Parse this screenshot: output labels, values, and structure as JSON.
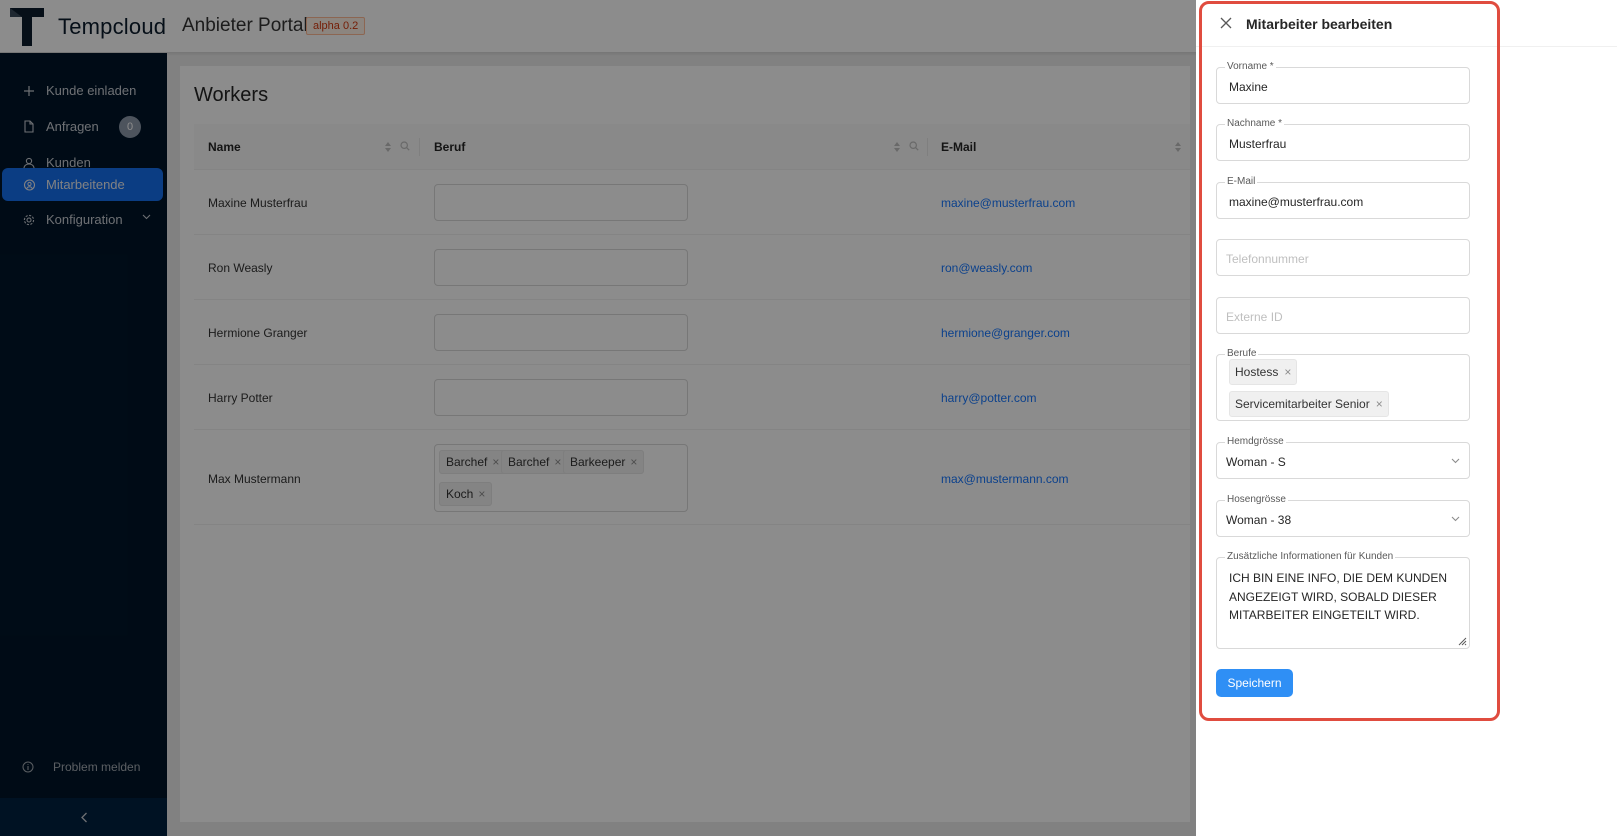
{
  "header": {
    "brand": "Tempcloud",
    "portal_title": "Anbieter Portal",
    "version_tag": "alpha 0.2"
  },
  "sidebar": {
    "items": [
      {
        "label": "Kunde einladen",
        "icon": "plus-icon"
      },
      {
        "label": "Anfragen",
        "icon": "file-icon",
        "badge": "0"
      },
      {
        "label": "Kunden",
        "icon": "user-icon"
      },
      {
        "label": "Mitarbeitende",
        "icon": "team-icon",
        "active": true
      },
      {
        "label": "Konfiguration",
        "icon": "gear-icon"
      }
    ],
    "footer": {
      "label": "Problem melden",
      "icon": "info-icon"
    },
    "collapse_icon": "chevron-left-icon"
  },
  "main": {
    "title": "Workers",
    "columns": [
      "Name",
      "Beruf",
      "E-Mail"
    ],
    "rows": [
      {
        "name": "Maxine Musterfrau",
        "email": "maxine@musterfrau.com",
        "tags": []
      },
      {
        "name": "Ron Weasly",
        "email": "ron@weasly.com",
        "tags": []
      },
      {
        "name": "Hermione Granger",
        "email": "hermione@granger.com",
        "tags": []
      },
      {
        "name": "Harry Potter",
        "email": "harry@potter.com",
        "tags": []
      },
      {
        "name": "Max Mustermann",
        "email": "max@mustermann.com",
        "tags": [
          "Barchef",
          "Barchef",
          "Barkeeper",
          "Koch"
        ]
      }
    ]
  },
  "drawer": {
    "title": "Mitarbeiter bearbeiten",
    "fields": {
      "vorname": {
        "label": "Vorname *",
        "value": "Maxine"
      },
      "nachname": {
        "label": "Nachname *",
        "value": "Musterfrau"
      },
      "email": {
        "label": "E-Mail",
        "value": "maxine@musterfrau.com"
      },
      "telefon": {
        "placeholder": "Telefonnummer"
      },
      "externe_id": {
        "placeholder": "Externe ID"
      },
      "berufe": {
        "label": "Berufe",
        "tags": [
          "Hostess",
          "Servicemitarbeiter Senior"
        ]
      },
      "hemdgroesse": {
        "label": "Hemdgrösse",
        "value": "Woman - S"
      },
      "hosengroesse": {
        "label": "Hosengrösse",
        "value": "Woman - 38"
      },
      "zusatzinfo": {
        "label": "Zusätzliche Informationen für Kunden",
        "value": "ICH BIN EINE INFO, DIE DEM KUNDEN ANGEZEIGT WIRD, SOBALD DIESER MITARBEITER EINGETEILT WIRD."
      }
    },
    "save_label": "Speichern"
  },
  "colors": {
    "sidebar_bg": "#001529",
    "accent": "#1677ff",
    "highlight": "#e04c3f",
    "version_tag": "#d4380d"
  }
}
